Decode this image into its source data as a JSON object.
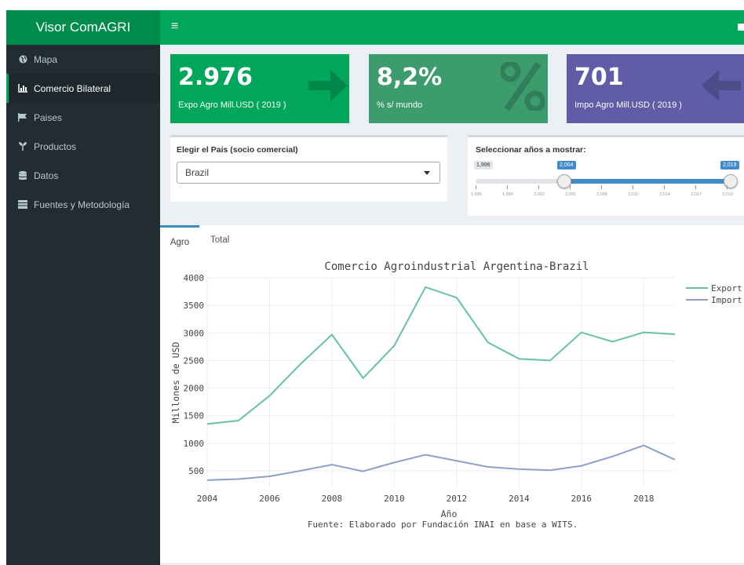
{
  "app": {
    "title": "Visor ComAGRI"
  },
  "sidebar": {
    "items": [
      {
        "label": "Mapa",
        "icon": "globe-icon"
      },
      {
        "label": "Comercio Bilateral",
        "icon": "line-chart-icon",
        "active": true
      },
      {
        "label": "Paises",
        "icon": "flag-icon"
      },
      {
        "label": "Productos",
        "icon": "seedling-icon"
      },
      {
        "label": "Datos",
        "icon": "database-icon"
      },
      {
        "label": "Fuentes y Metodología",
        "icon": "book-icon"
      }
    ]
  },
  "value_boxes": [
    {
      "value": "2.976",
      "subtitle": "Expo Agro Mill.USD ( 2019 )",
      "color": "#00a65a",
      "icon": "arrow-right-icon"
    },
    {
      "value": "8,2%",
      "subtitle": "% s/ mundo",
      "color": "#3c9c6e",
      "icon": "percent-icon"
    },
    {
      "value": "701",
      "subtitle": "Impo Agro Mill.USD ( 2019 )",
      "color": "#605ca8",
      "icon": "arrow-left-icon"
    }
  ],
  "country_select": {
    "label": "Elegir el Pais (socio comercial)",
    "value": "Brazil"
  },
  "year_slider": {
    "label": "Seleccionar años a mostrar:",
    "min_label": "1,996",
    "from_label": "2,004",
    "to_label": "2,019",
    "min": 1996,
    "max": 2019,
    "from": 2004,
    "to": 2019,
    "grid_labels": [
      "1,996",
      "1,999",
      "2,002",
      "2,005",
      "2,008",
      "2,011",
      "2,014",
      "2,017",
      "2,019"
    ]
  },
  "tabs": [
    {
      "label": "Agro",
      "active": true
    },
    {
      "label": "Total",
      "active": false
    }
  ],
  "chart_note": "Fuente: Elaborado por Fundación INAI en base a WITS.",
  "chart_data": {
    "type": "line",
    "title": "Comercio Agroindustrial Argentina-Brazil",
    "xlabel": "Año",
    "ylabel": "Millones de USD",
    "x": [
      2004,
      2005,
      2006,
      2007,
      2008,
      2009,
      2010,
      2011,
      2012,
      2013,
      2014,
      2015,
      2016,
      2017,
      2018,
      2019
    ],
    "series": [
      {
        "name": "Export",
        "color": "#66c2a5",
        "values": [
          1350,
          1410,
          1860,
          2440,
          2970,
          2180,
          2770,
          3830,
          3640,
          2830,
          2530,
          2500,
          3010,
          2840,
          3010,
          2976
        ]
      },
      {
        "name": "Import",
        "color": "#8da0cb",
        "values": [
          330,
          350,
          400,
          500,
          610,
          490,
          650,
          790,
          680,
          570,
          530,
          510,
          590,
          760,
          960,
          701
        ]
      }
    ],
    "xlim": [
      2004,
      2019
    ],
    "ylim": [
      200,
      4000
    ],
    "xticks": [
      "2004",
      "2006",
      "2008",
      "2010",
      "2012",
      "2014",
      "2016",
      "2018"
    ],
    "yticks": [
      "500",
      "1000",
      "1500",
      "2000",
      "2500",
      "3000",
      "3500",
      "4000"
    ],
    "grid": true,
    "legend_position": "top-right"
  }
}
